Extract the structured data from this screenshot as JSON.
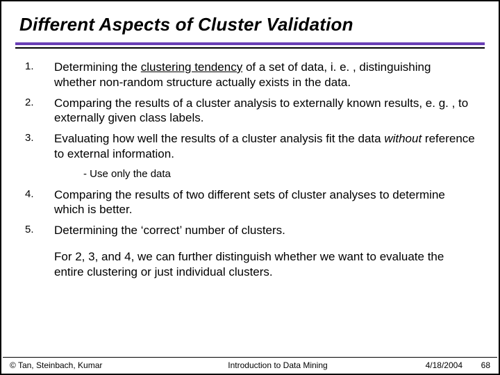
{
  "title": "Different Aspects of Cluster Validation",
  "items": [
    {
      "num": "1.",
      "pre": "Determining the ",
      "underlined": "clustering tendency",
      "post": " of a set of data, i. e. , distinguishing whether non-random structure actually exists in the data."
    },
    {
      "num": "2.",
      "pre": "Comparing the results of a cluster analysis to externally known results, e. g. , to externally given class labels.",
      "underlined": "",
      "post": ""
    },
    {
      "num": "3.",
      "pre": "Evaluating how well the results of a cluster analysis fit the data ",
      "italic": "without",
      "post": " reference to external information.",
      "sub": "- Use only the data"
    },
    {
      "num": "4.",
      "pre": "Comparing the results of two different sets of cluster analyses to determine which is better.",
      "underlined": "",
      "post": ""
    },
    {
      "num": "5.",
      "pre": "Determining the ‘correct’ number of clusters.",
      "underlined": "",
      "post": ""
    }
  ],
  "closing": "For 2, 3, and 4, we can further distinguish whether we want to evaluate the entire clustering or just individual clusters.",
  "footer": {
    "copyright": "© Tan, Steinbach, Kumar",
    "center": "Introduction to Data Mining",
    "date": "4/18/2004",
    "page": "68"
  }
}
